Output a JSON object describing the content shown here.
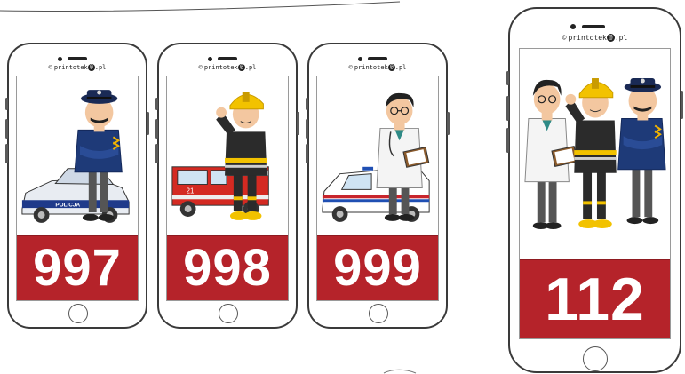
{
  "brand": {
    "copyright": "©",
    "text_before": "printotek",
    "text_after": ".pl",
    "at_symbol": "@"
  },
  "colors": {
    "number_background": "#b5232a",
    "number_text": "#ffffff",
    "phone_outline": "#3a3a3a"
  },
  "phones": [
    {
      "number": "997",
      "illustration": "police-officer-with-police-car",
      "car_text": "POLICJA"
    },
    {
      "number": "998",
      "illustration": "firefighter-with-fire-truck",
      "truck_text": "21"
    },
    {
      "number": "999",
      "illustration": "doctor-with-ambulance"
    },
    {
      "number": "112",
      "illustration": "doctor-firefighter-police-officer-group"
    }
  ]
}
